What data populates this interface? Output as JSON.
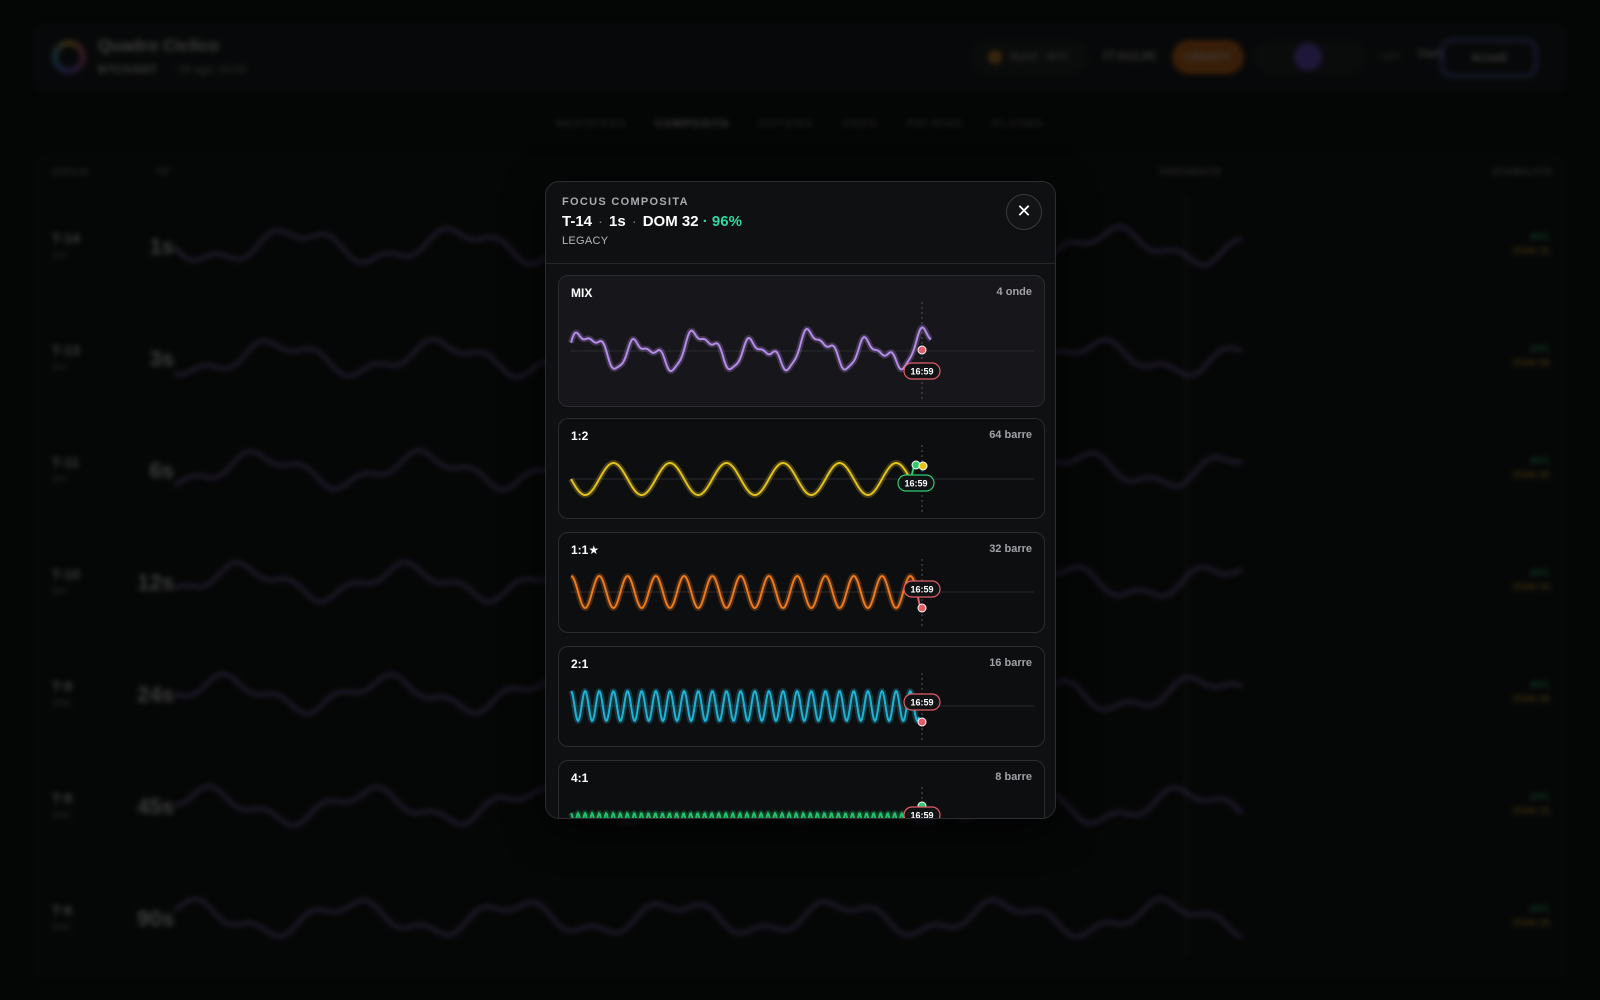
{
  "app": {
    "title": "Quadro Ciclico",
    "symbol": "BTC/USDT",
    "timestamp": "· 26 ago, 16:59",
    "exchange": "Bybit · BTC",
    "price": "77.612,00",
    "mode_badge": "LEGACY",
    "group_label": "4%",
    "group_avatar": "IR",
    "theme_light": "Light",
    "theme_dark": "Dark",
    "login": "Accedi"
  },
  "tabs": [
    "MERIDIANA",
    "COMPOSITA",
    "SISTEMA",
    "ONDA",
    "PHI-RING",
    "PLASMA"
  ],
  "active_tab": "COMPOSITA",
  "table": {
    "col_cycle": "CICLO",
    "col_tf": "TF",
    "col_present": "PRESENTE",
    "col_stability": "STABILITÀ",
    "rows": [
      {
        "id": "T-14",
        "sub": "1m",
        "tf": "1s",
        "pct": "96%",
        "dom": "DOM 32"
      },
      {
        "id": "T-13",
        "sub": "2m",
        "tf": "3s",
        "pct": "93%",
        "dom": "DOM 38"
      },
      {
        "id": "T-11",
        "sub": "4m",
        "tf": "6s",
        "pct": "98%",
        "dom": "DOM 40"
      },
      {
        "id": "T-10",
        "sub": "8m",
        "tf": "12s",
        "pct": "95%",
        "dom": "DOM 44"
      },
      {
        "id": "T-9",
        "sub": "16m",
        "tf": "24s",
        "pct": "96%",
        "dom": "DOM 48"
      },
      {
        "id": "T-8",
        "sub": "24m",
        "tf": "45s",
        "pct": "93%",
        "dom": "DOM 33"
      },
      {
        "id": "T-6",
        "sub": "54m",
        "tf": "90s",
        "pct": "89%",
        "dom": "DOM 28"
      }
    ]
  },
  "modal": {
    "eyebrow": "FOCUS COMPOSITA",
    "cycle": "T-14",
    "tf": "1s",
    "dom": "DOM 32",
    "pct": "· 96%",
    "mode": "LEGACY",
    "close_icon": "close-icon",
    "time_label": "16:59",
    "colors": {
      "mix": "#b58ce8",
      "half": "#e3c21a",
      "one": "#ef7a1a",
      "two": "#1fb2d4",
      "four": "#20c06a",
      "red": "#e35d68",
      "green": "#2ecc71"
    },
    "cards": [
      {
        "key": "mix",
        "label": "MIX",
        "meta": "4 onde"
      },
      {
        "key": "half",
        "label": "1:2",
        "meta": "64 barre"
      },
      {
        "key": "one",
        "label": "1:1★",
        "meta": "32 barre"
      },
      {
        "key": "two",
        "label": "2:1",
        "meta": "16 barre"
      },
      {
        "key": "four",
        "label": "4:1",
        "meta": "8 barre"
      }
    ]
  }
}
